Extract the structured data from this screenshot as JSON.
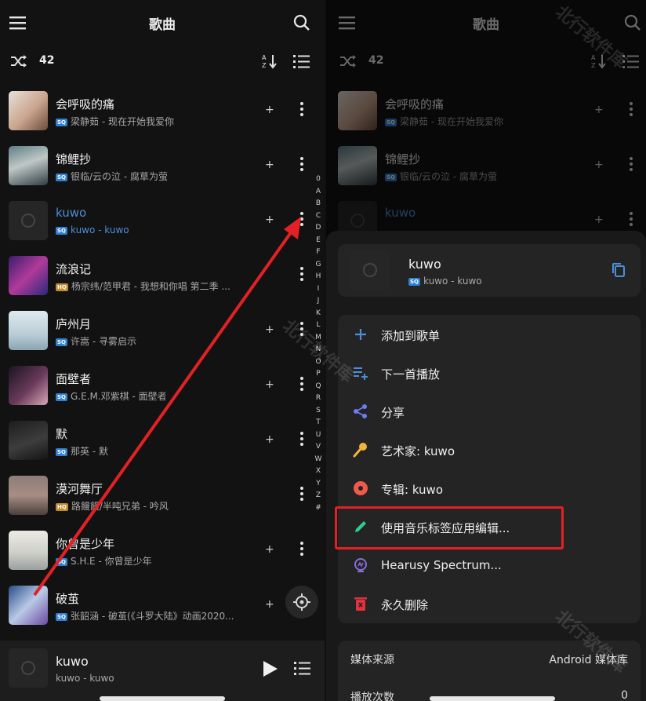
{
  "topbar": {
    "title": "歌曲"
  },
  "sortbar": {
    "count": "42"
  },
  "songs": [
    {
      "title": "会呼吸的痛",
      "quality": "SQ",
      "subtitle": "梁静茹 - 现在开始我爱你",
      "art": "photo"
    },
    {
      "title": "锦鲤抄",
      "quality": "SQ",
      "subtitle": "银临/云の泣 - 腐草为萤",
      "art": "photo"
    },
    {
      "title": "kuwo",
      "quality": "SQ",
      "subtitle": "kuwo - kuwo",
      "art": "placeholder"
    },
    {
      "title": "流浪记",
      "quality": "HQ",
      "subtitle": "杨宗纬/范甲君 - 我想和你唱 第二季 ...",
      "art": "photo"
    },
    {
      "title": "庐州月",
      "quality": "SQ",
      "subtitle": "许嵩 - 寻雾启示",
      "art": "photo"
    },
    {
      "title": "面壁者",
      "quality": "SQ",
      "subtitle": "G.E.M.邓紫棋 - 面壁者",
      "art": "photo"
    },
    {
      "title": "默",
      "quality": "SQ",
      "subtitle": "那英 - 默",
      "art": "photo"
    },
    {
      "title": "漠河舞厅",
      "quality": "HQ",
      "subtitle": "路饅饅/半吨兄弟 - 吟风",
      "art": "photo"
    },
    {
      "title": "你曾是少年",
      "quality": "SQ",
      "subtitle": "S.H.E - 你曾是少年",
      "art": "photo"
    },
    {
      "title": "破茧",
      "quality": "SQ",
      "subtitle": "张韶涵 - 破茧(《斗罗大陆》动画2020...",
      "art": "photo"
    }
  ],
  "alphabet": [
    "0",
    "A",
    "B",
    "C",
    "D",
    "E",
    "F",
    "G",
    "H",
    "I",
    "J",
    "K",
    "L",
    "M",
    "N",
    "O",
    "P",
    "Q",
    "R",
    "S",
    "T",
    "U",
    "V",
    "W",
    "X",
    "Y",
    "Z",
    "#"
  ],
  "now_playing": {
    "title": "kuwo",
    "subtitle": "kuwo - kuwo"
  },
  "sheet": {
    "song": {
      "title": "kuwo",
      "quality": "SQ",
      "subtitle": "kuwo - kuwo"
    },
    "menu": [
      {
        "label": "添加到歌单",
        "icon": "plus-icon",
        "color": "#4b8fd6"
      },
      {
        "label": "下一首播放",
        "icon": "queue-next-icon",
        "color": "#4b8fd6"
      },
      {
        "label": "分享",
        "icon": "share-icon",
        "color": "#6f7bf7"
      },
      {
        "label": "艺术家: kuwo",
        "icon": "microphone-icon",
        "color": "#f0b43a"
      },
      {
        "label": "专辑: kuwo",
        "icon": "album-icon",
        "color": "#f05a4a"
      },
      {
        "label": "使用音乐标签应用编辑...",
        "icon": "pencil-icon",
        "color": "#2fce8c"
      },
      {
        "label": "Hearusy Spectrum...",
        "icon": "spectrum-app-icon",
        "color": "#8a6cd6"
      },
      {
        "label": "永久删除",
        "icon": "trash-icon",
        "color": "#e0323c"
      }
    ],
    "info": [
      {
        "key": "媒体来源",
        "value": "Android 媒体库"
      },
      {
        "key": "播放次数",
        "value": "0"
      }
    ]
  },
  "watermark": "北行软件库",
  "colors": {
    "accent": "#4b8fd6",
    "highlight": "#e32125"
  }
}
